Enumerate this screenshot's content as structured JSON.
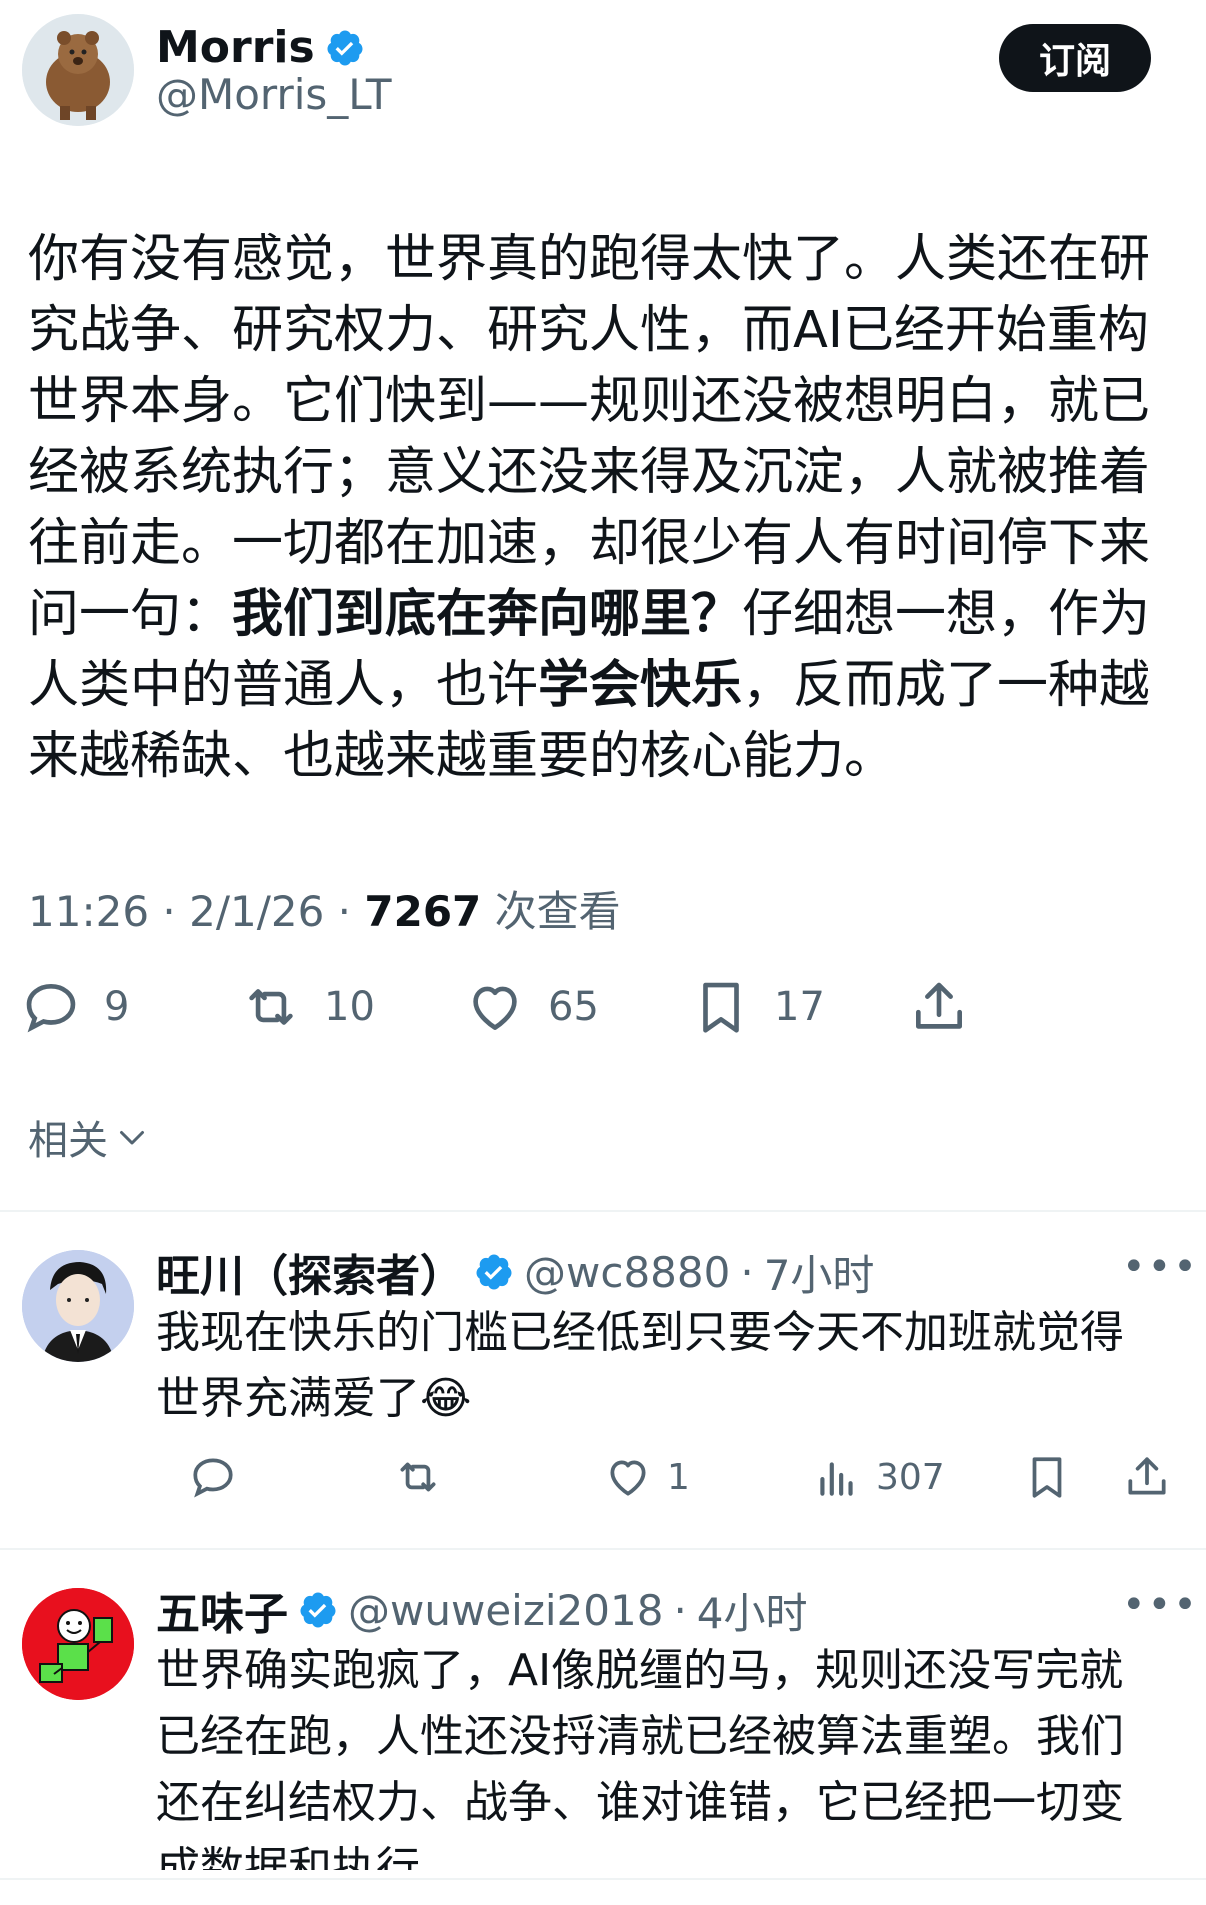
{
  "author": {
    "name": "Morris",
    "handle": "@Morris_LT",
    "subscribe_label": "订阅"
  },
  "tweet": {
    "text_parts": [
      {
        "text": "你有没有感觉，世界真的跑得太快了。人类还在研究战争、研究权力、研究人性，而AI已经开始重构世界本身。它们快到——规则还没被想明白，就已经被系统执行；意义还没来得及沉淀，人就被推着往前走。一切都在加速，却很少有人有时间停下来问一句：",
        "bold": false
      },
      {
        "text": "我们到底在奔向哪里？",
        "bold": true
      },
      {
        "text": "仔细想一想，作为人类中的普通人，也许",
        "bold": false
      },
      {
        "text": "学会快乐",
        "bold": true
      },
      {
        "text": "，反而成了一种越来越稀缺、也越来越重要的核心能力。",
        "bold": false
      }
    ],
    "time": "11:26",
    "date": "2/1/26",
    "views": "7267",
    "views_label": "次查看",
    "stats": {
      "replies": "9",
      "retweets": "10",
      "likes": "65",
      "bookmarks": "17"
    }
  },
  "related_label": "相关",
  "replies": [
    {
      "name": "旺川（探索者）",
      "handle": "@wc8880",
      "time": "7小时",
      "text": "我现在快乐的门槛已经低到只要今天不加班就觉得世界充满爱了😂",
      "stats": {
        "likes": "1",
        "views": "307"
      }
    },
    {
      "name": "五味子",
      "handle": "@wuweizi2018",
      "time": "4小时",
      "text": "世界确实跑疯了，AI像脱缰的马，规则还没写完就已经在跑，人性还没捋清就已经被算法重塑。我们还在纠结权力、战争、谁对谁错，它已经把一切变成数据和执行。"
    }
  ],
  "colors": {
    "accent": "#1d9bf0",
    "text": "#0f1419",
    "muted": "#536471"
  }
}
